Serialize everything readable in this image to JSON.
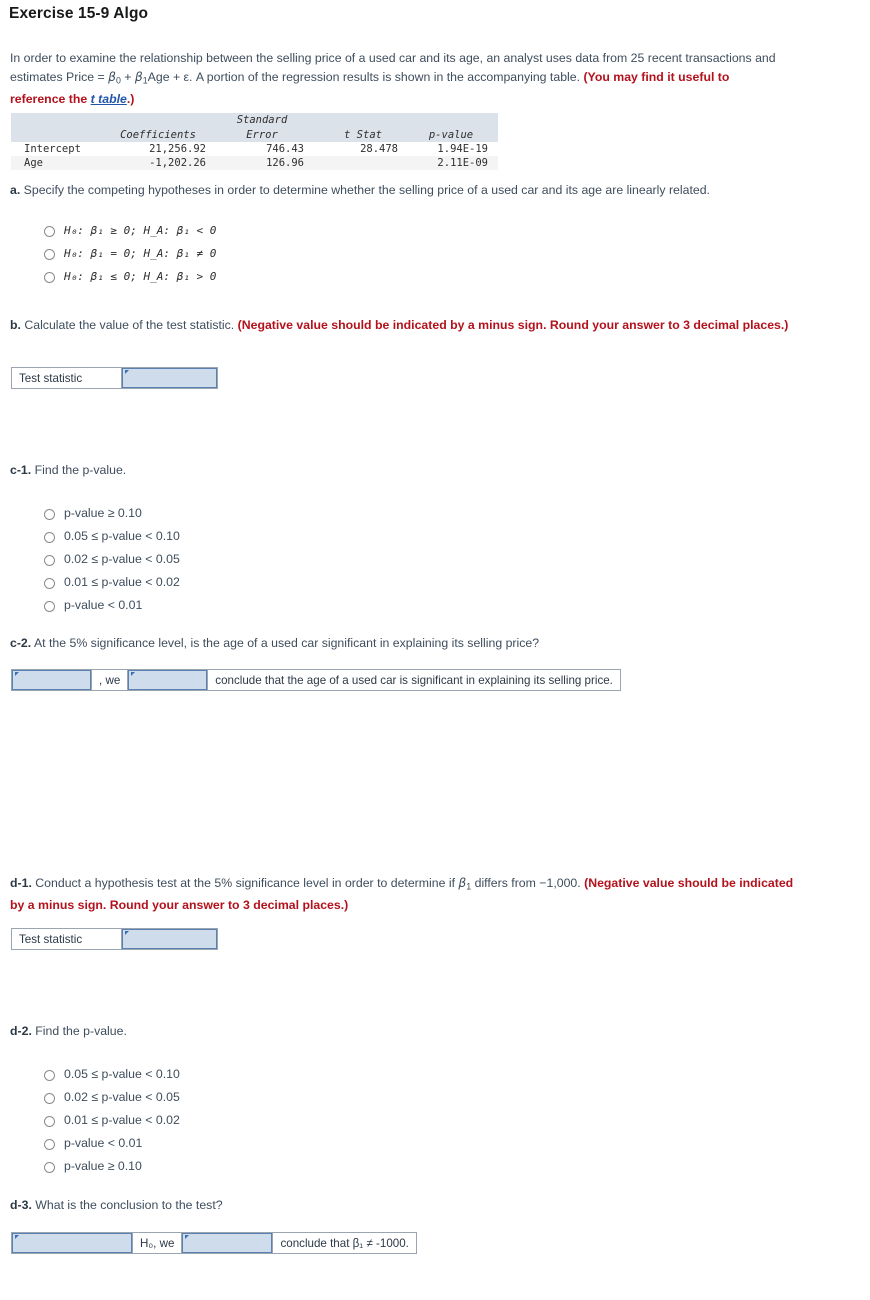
{
  "title": "Exercise 15-9 Algo",
  "intro": {
    "part1": "In order to examine the relationship between the selling price of a used car and its age, an analyst uses data from 25 recent transactions and estimates Price = ",
    "beta0": "β",
    "sub0": "0",
    "mid1": " + ",
    "beta1": "β",
    "sub1": "1",
    "mid2": "Age + ε. A portion of the regression results is shown in the accompanying table. ",
    "red_before": "(You may find it useful to reference the ",
    "link": "t table",
    "red_after": ".)"
  },
  "regression_table": {
    "headers": [
      "",
      "Coefficients",
      "Standard Error",
      "t Stat",
      "p-value"
    ],
    "header_line1": [
      "",
      "",
      "Standard",
      "",
      ""
    ],
    "header_line2": [
      "",
      "Coefficients",
      "Error",
      "t Stat",
      "p-value"
    ],
    "rows": [
      {
        "label": "Intercept",
        "coefficient": "21,256.92",
        "std_error": "746.43",
        "t_stat": "28.478",
        "p_value": "1.94E-19"
      },
      {
        "label": "Age",
        "coefficient": "-1,202.26",
        "std_error": "126.96",
        "t_stat": "",
        "p_value": "2.11E-09"
      }
    ]
  },
  "part_a": {
    "label": "a.",
    "prompt": " Specify the competing hypotheses in order to determine whether the selling price of a used car and its age are linearly related.",
    "options": [
      "H₀: β₁ ≥ 0; H_A: β₁ < 0",
      "H₀: β₁ = 0; H_A: β₁ ≠ 0",
      "H₀: β₁ ≤ 0; H_A: β₁ > 0"
    ],
    "options_raw": [
      {
        "h0": "H0: β1 ≥ 0;",
        "ha": "HA: β1 < 0"
      },
      {
        "h0": "H0: β1 = 0;",
        "ha": "HA: β1 ≠ 0"
      },
      {
        "h0": "H0: β1 ≤ 0;",
        "ha": "HA: β1 > 0"
      }
    ]
  },
  "part_b": {
    "label": "b.",
    "prompt": " Calculate the value of the test statistic. ",
    "red": "(Negative value should be indicated by a minus sign. Round your answer to 3 decimal places.)",
    "field_label": "Test statistic",
    "field_value": ""
  },
  "part_c1": {
    "label": "c-1.",
    "prompt": " Find the p-value.",
    "options": [
      "p-value ≥ 0.10",
      "0.05 ≤ p-value < 0.10",
      "0.02 ≤ p-value < 0.05",
      "0.01 ≤ p-value < 0.02",
      "p-value < 0.01"
    ]
  },
  "part_c2": {
    "label": "c-2.",
    "prompt": " At the 5% significance level, is the age of a used car significant in explaining its selling price?",
    "field1_value": "",
    "middle_text": ", we",
    "field2_value": "",
    "tail_text": "conclude that the age of a used car is significant in explaining its selling price."
  },
  "part_d1": {
    "label": "d-1.",
    "prompt_a": " Conduct a hypothesis test at the 5% significance level in order to determine if ",
    "beta": "β",
    "beta_sub": "1",
    "prompt_b": " differs from −1,000. ",
    "red": "(Negative value should be indicated by a minus sign. Round your answer to 3 decimal places.)",
    "field_label": "Test statistic",
    "field_value": ""
  },
  "part_d2": {
    "label": "d-2.",
    "prompt": " Find the p-value.",
    "options": [
      "0.05 ≤ p-value < 0.10",
      "0.02 ≤ p-value < 0.05",
      "0.01 ≤ p-value < 0.02",
      "p-value < 0.01",
      "p-value ≥ 0.10"
    ]
  },
  "part_d3": {
    "label": "d-3.",
    "prompt": " What is the conclusion to the test?",
    "field1_value": "",
    "middle_text": "H₀, we",
    "field2_value": "",
    "tail_text": "conclude that β₁ ≠ -1000."
  },
  "colors": {
    "body_text": "#3e4d5c",
    "red_emphasis": "#b3121c",
    "link": "#2255aa",
    "table_header_bg": "#dbe2ea",
    "field_bg": "#cfdceb",
    "field_border": "#5b81b0"
  }
}
